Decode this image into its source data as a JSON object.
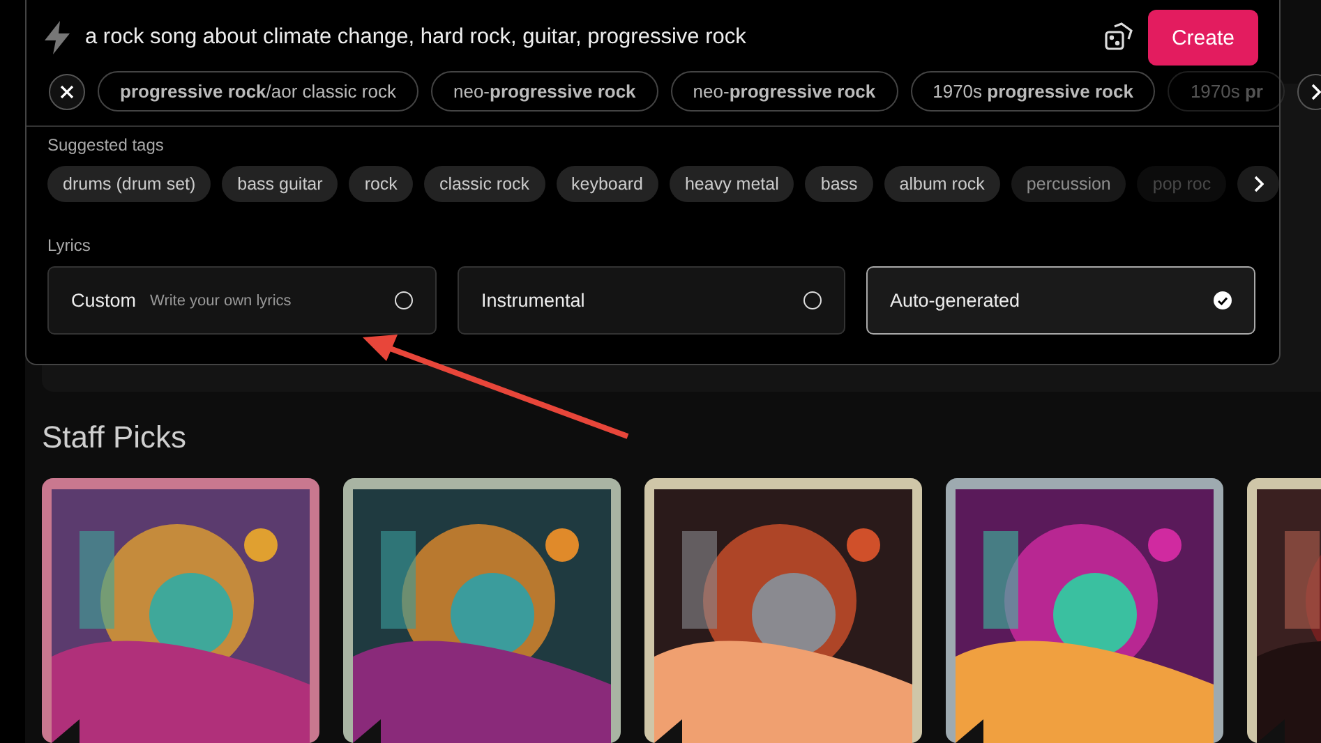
{
  "prompt": {
    "value": "a rock song about climate change, hard rock, guitar, progressive rock"
  },
  "create_button": "Create",
  "style_chips": [
    "**progressive rock**/aor classic rock",
    "neo-**progressive rock**",
    "neo-**progressive rock**",
    "1970s **progressive rock**",
    "1970s **pr**"
  ],
  "suggested_tags": {
    "label": "Suggested tags",
    "items": [
      "drums (drum set)",
      "bass guitar",
      "rock",
      "classic rock",
      "keyboard",
      "heavy metal",
      "bass",
      "album rock",
      "percussion",
      "pop roc"
    ]
  },
  "lyrics": {
    "label": "Lyrics",
    "options": [
      {
        "label": "Custom",
        "hint": "Write your own lyrics",
        "selected": false
      },
      {
        "label": "Instrumental",
        "selected": false
      },
      {
        "label": "Auto-generated",
        "selected": true
      }
    ]
  },
  "staff_picks": {
    "title": "Staff Picks"
  }
}
